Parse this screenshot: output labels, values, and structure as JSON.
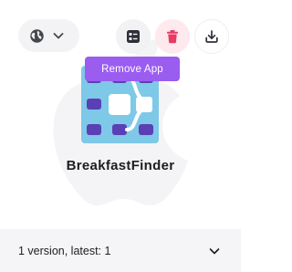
{
  "app": {
    "name": "BreakfastFinder"
  },
  "tooltip": {
    "label": "Remove App"
  },
  "toolbar": {
    "language_icon": "globe-icon",
    "language_chevron_icon": "chevron-down-icon",
    "details_icon": "list-details-icon",
    "remove_icon": "trash-icon",
    "download_icon": "download-icon"
  },
  "versions": {
    "summary": "1 version, latest: 1",
    "toggle_icon": "chevron-down-icon"
  },
  "colors": {
    "accent_purple": "#9b5cf0",
    "remove_red": "#e83a62",
    "icon_blue": "#7ec8e8",
    "icon_purple": "#5b3fb5"
  }
}
